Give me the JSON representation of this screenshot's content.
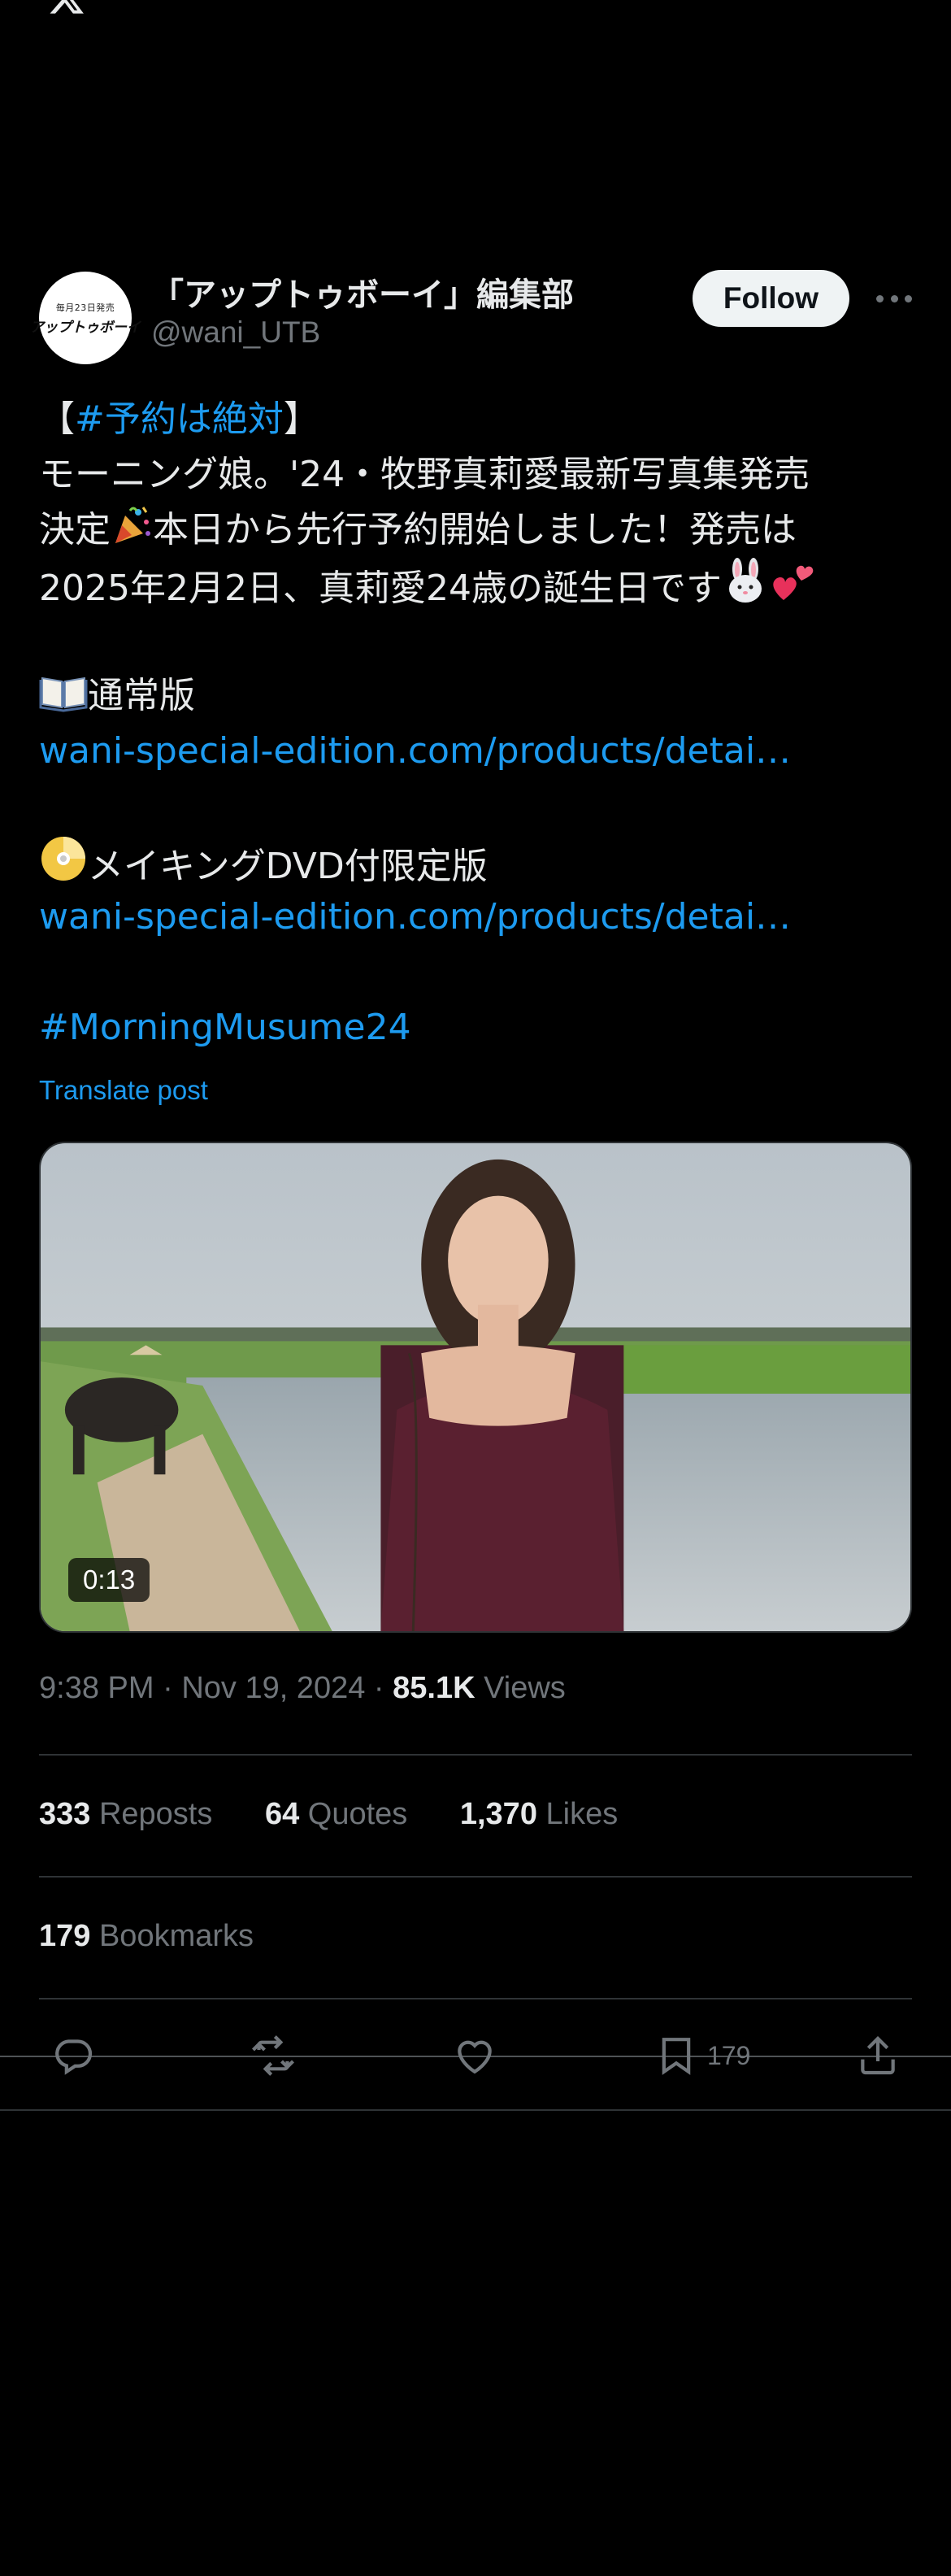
{
  "app": {
    "logo_icon": "x-logo-icon"
  },
  "author": {
    "name": "「アップトゥボーイ」編集部",
    "handle": "@wani_UTB",
    "avatar_top": "毎月23日発売",
    "avatar_logo": "アップトゥボーイ",
    "follow_label": "Follow",
    "more_icon": "more-icon"
  },
  "post": {
    "line1_open": "【",
    "line1_tag": "#予約は絶対",
    "line1_close": "】",
    "line2": "モーニング娘。'24・牧野真莉愛最新写真集発売",
    "line3_a": "決定",
    "line3_b": "本日から先行予約開始しました！発売は",
    "line4": "2025年2月2日、真莉愛24歳の誕生日です",
    "regular_label": "通常版",
    "regular_link": "wani-special-edition.com/products/detai…",
    "dvd_label": "メイキングDVD付限定版",
    "dvd_link": "wani-special-edition.com/products/detai…",
    "hashtag": "#MorningMusume24",
    "translate": "Translate post"
  },
  "media": {
    "duration": "0:13"
  },
  "meta": {
    "time": "9:38 PM",
    "sep1": " · ",
    "date": "Nov 19, 2024",
    "sep2": " · ",
    "views_count": "85.1K",
    "views_label": " Views"
  },
  "stats": {
    "reposts_count": "333",
    "reposts_label": " Reposts",
    "quotes_count": "64",
    "quotes_label": " Quotes",
    "likes_count": "1,370",
    "likes_label": " Likes",
    "bookmarks_count": "179",
    "bookmarks_label": " Bookmarks"
  },
  "actions": {
    "reply_icon": "reply-icon",
    "repost_icon": "repost-icon",
    "like_icon": "like-icon",
    "bookmark_icon": "bookmark-icon",
    "bookmark_count": "179",
    "share_icon": "share-icon"
  },
  "colors": {
    "accent": "#1d9bf0",
    "background": "#000000",
    "text": "#e7e9ea",
    "muted": "#71767b",
    "divider": "#2f3336"
  }
}
